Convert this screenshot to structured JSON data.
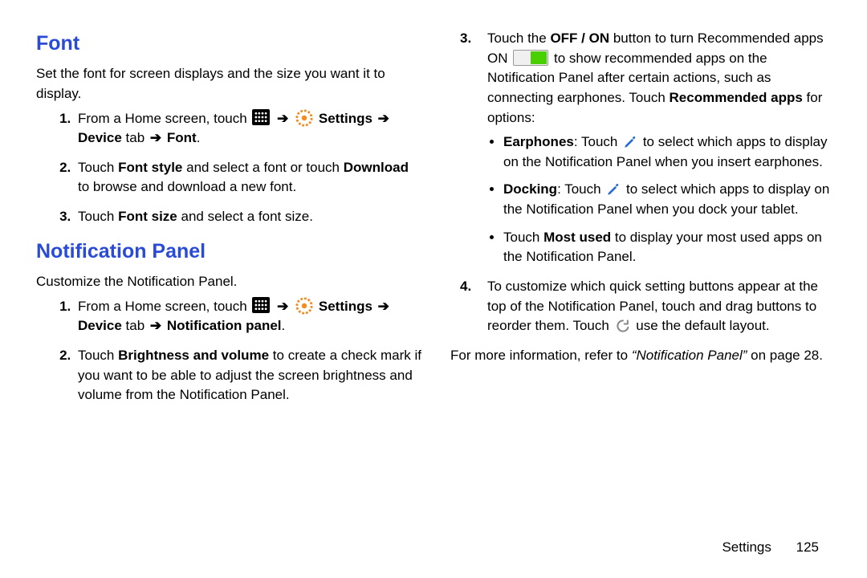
{
  "arrow": "➔",
  "left": {
    "font_heading": "Font",
    "font_intro": "Set the font for screen displays and the size you want it to display.",
    "font_steps": {
      "s1_a": "From a Home screen, touch ",
      "s1_settings": "Settings",
      "s1_device_tab": "Device",
      "s1_tab_word": " tab ",
      "s1_font": "Font",
      "s2_a": "Touch ",
      "s2_fontstyle": "Font style",
      "s2_b": " and select a font or touch ",
      "s2_download": "Download",
      "s2_c": " to browse and download a new font.",
      "s3_a": "Touch ",
      "s3_fontsize": "Font size",
      "s3_b": " and select a font size."
    },
    "np_heading": "Notification Panel",
    "np_intro": "Customize the Notification Panel.",
    "np_steps": {
      "s1_a": "From a Home screen, touch ",
      "s1_settings": "Settings",
      "s1_device_tab": "Device",
      "s1_tab_word": " tab ",
      "s1_np": "Notification panel",
      "s2_a": "Touch ",
      "s2_bv": "Brightness and volume",
      "s2_b": " to create a check mark if you want to be able to adjust the screen brightness and volume from the Notification Panel."
    }
  },
  "right": {
    "s3_a": "Touch the ",
    "s3_offon": "OFF / ON",
    "s3_b": " button to turn Recommended apps ON ",
    "s3_c": " to show recommended apps on the Notification Panel after certain actions, such as connecting earphones. Touch ",
    "s3_recapps": "Recommended apps",
    "s3_d": " for options:",
    "sub": {
      "earphones_label": "Earphones",
      "earphones_a": ": Touch ",
      "earphones_b": " to select which apps to display on the Notification Panel when you insert earphones.",
      "docking_label": "Docking",
      "docking_a": ": Touch ",
      "docking_b": " to select which apps to display on the Notification Panel when you dock your tablet.",
      "mostused_a": "Touch ",
      "mostused_label": "Most used",
      "mostused_b": " to display your most used apps on the Notification Panel."
    },
    "s4_a": "To customize which quick setting buttons appear at the top of the Notification Panel, touch and drag buttons to reorder them. Touch ",
    "s4_b": " use the default layout.",
    "more_a": "For more information, refer to ",
    "more_ref": "“Notification Panel”",
    "more_b": " on page 28."
  },
  "footer": {
    "section": "Settings",
    "page": "125"
  }
}
